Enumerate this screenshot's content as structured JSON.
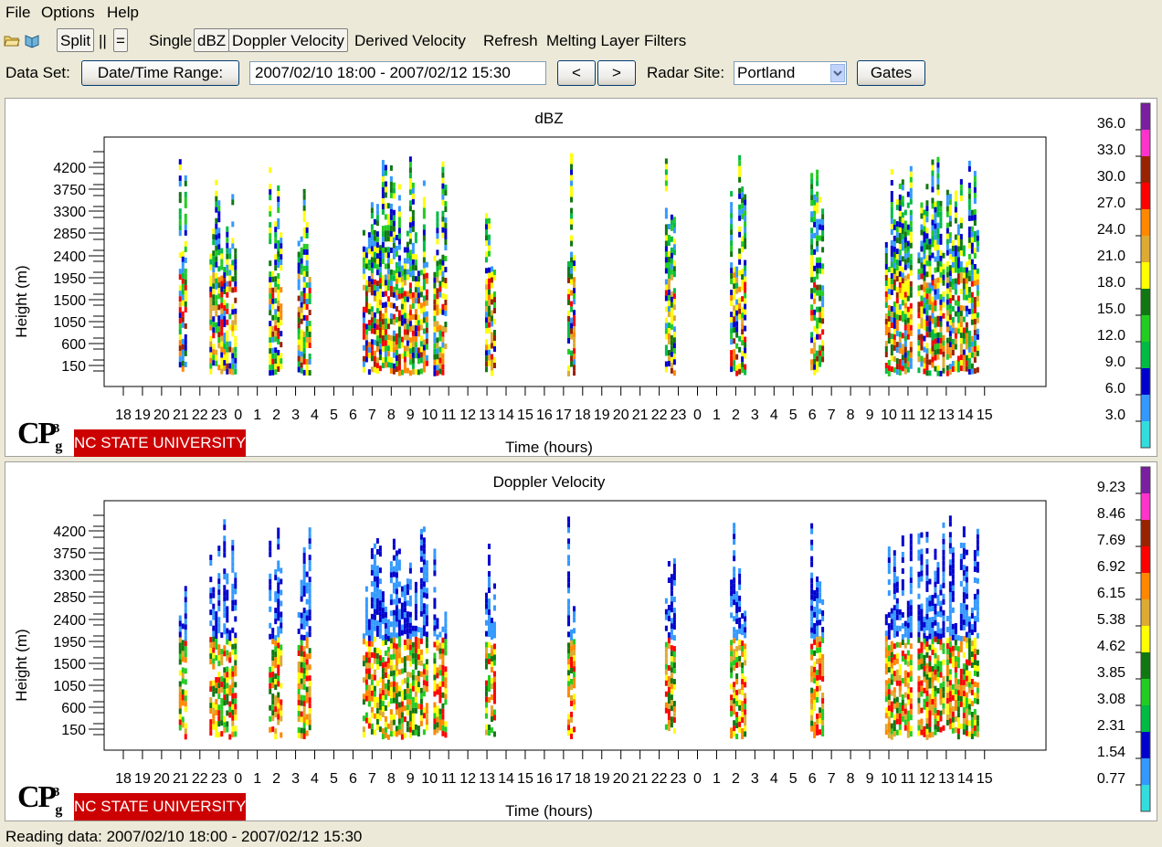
{
  "menu": {
    "file": "File",
    "options": "Options",
    "help": "Help"
  },
  "toolbar": {
    "icons": [
      "open-folder-icon",
      "book-icon"
    ],
    "split": "Split",
    "parallel": "||",
    "equal": "=",
    "single": "Single",
    "dbz": "dBZ",
    "doppler": "Doppler Velocity",
    "derived": "Derived Velocity",
    "refresh": "Refresh",
    "melting": "Melting Layer",
    "filters": "Filters"
  },
  "dataset": {
    "label": "Data Set:",
    "date_button": "Date/Time Range:",
    "range_value": "2007/02/10 18:00 - 2007/02/12 15:30",
    "prev": "<",
    "next": ">",
    "site_label": "Radar Site:",
    "site_value": "Portland",
    "gates": "Gates"
  },
  "branding": {
    "logo_text": "CP3g",
    "university": "NC STATE UNIVERSITY",
    "university_color": "#cc0000"
  },
  "status": "Reading data: 2007/02/10 18:00 - 2007/02/12 15:30",
  "chart_data": [
    {
      "type": "heatmap",
      "title": "dBZ",
      "xlabel": "Time (hours)",
      "ylabel": "Height (m)",
      "x_ticks": [
        "18",
        "19",
        "20",
        "21",
        "22",
        "23",
        "0",
        "1",
        "2",
        "3",
        "4",
        "5",
        "6",
        "7",
        "8",
        "9",
        "10",
        "11",
        "12",
        "13",
        "14",
        "15",
        "16",
        "17",
        "18",
        "19",
        "20",
        "21",
        "22",
        "23",
        "0",
        "1",
        "2",
        "3",
        "4",
        "5",
        "6",
        "7",
        "8",
        "9",
        "10",
        "11",
        "12",
        "13",
        "14",
        "15"
      ],
      "y_ticks": [
        "4200",
        "3750",
        "3300",
        "2850",
        "2400",
        "1950",
        "1500",
        "1050",
        "600",
        "150"
      ],
      "colorbar": {
        "labels": [
          "36.0",
          "33.0",
          "30.0",
          "27.0",
          "24.0",
          "21.0",
          "18.0",
          "15.0",
          "12.0",
          "9.0",
          "6.0",
          "3.0"
        ],
        "colors": [
          "#7a1fa0",
          "#ff33cc",
          "#992200",
          "#ff0000",
          "#ff8800",
          "#ddaa33",
          "#ffff00",
          "#117711",
          "#22cc22",
          "#00bb44",
          "#0000cc",
          "#3399ff",
          "#33dddd"
        ]
      },
      "echo_columns_hours": [
        [
          22.5,
          23.9
        ],
        [
          1.6,
          2.2
        ],
        [
          3.1,
          3.8
        ],
        [
          6.5,
          9.8
        ],
        [
          10.2,
          10.8
        ],
        [
          12.9,
          13.4
        ],
        [
          17.2,
          17.5
        ],
        [
          20.9,
          21.2
        ],
        [
          22.3,
          22.8
        ],
        [
          1.7,
          2.5
        ],
        [
          5.9,
          6.5
        ],
        [
          9.8,
          11.1
        ],
        [
          11.5,
          12.8
        ],
        [
          13.0,
          14.6
        ]
      ]
    },
    {
      "type": "heatmap",
      "title": "Doppler Velocity",
      "xlabel": "Time (hours)",
      "ylabel": "Height (m)",
      "x_ticks": [
        "18",
        "19",
        "20",
        "21",
        "22",
        "23",
        "0",
        "1",
        "2",
        "3",
        "4",
        "5",
        "6",
        "7",
        "8",
        "9",
        "10",
        "11",
        "12",
        "13",
        "14",
        "15",
        "16",
        "17",
        "18",
        "19",
        "20",
        "21",
        "22",
        "23",
        "0",
        "1",
        "2",
        "3",
        "4",
        "5",
        "6",
        "7",
        "8",
        "9",
        "10",
        "11",
        "12",
        "13",
        "14",
        "15"
      ],
      "y_ticks": [
        "4200",
        "3750",
        "3300",
        "2850",
        "2400",
        "1950",
        "1500",
        "1050",
        "600",
        "150"
      ],
      "colorbar": {
        "labels": [
          "9.23",
          "8.46",
          "7.69",
          "6.92",
          "6.15",
          "5.38",
          "4.62",
          "3.85",
          "3.08",
          "2.31",
          "1.54",
          "0.77"
        ],
        "colors": [
          "#7a1fa0",
          "#ff33cc",
          "#992200",
          "#ff0000",
          "#ff8800",
          "#ddaa33",
          "#ffff00",
          "#117711",
          "#22cc22",
          "#00bb44",
          "#0000cc",
          "#3399ff",
          "#33dddd"
        ]
      },
      "echo_columns_hours": [
        [
          22.5,
          23.9
        ],
        [
          1.6,
          2.2
        ],
        [
          3.1,
          3.8
        ],
        [
          6.5,
          9.8
        ],
        [
          10.2,
          10.8
        ],
        [
          12.9,
          13.4
        ],
        [
          17.2,
          17.5
        ],
        [
          20.9,
          21.2
        ],
        [
          22.3,
          22.8
        ],
        [
          1.7,
          2.5
        ],
        [
          5.9,
          6.5
        ],
        [
          9.8,
          11.1
        ],
        [
          11.5,
          12.8
        ],
        [
          13.0,
          14.6
        ]
      ]
    }
  ]
}
